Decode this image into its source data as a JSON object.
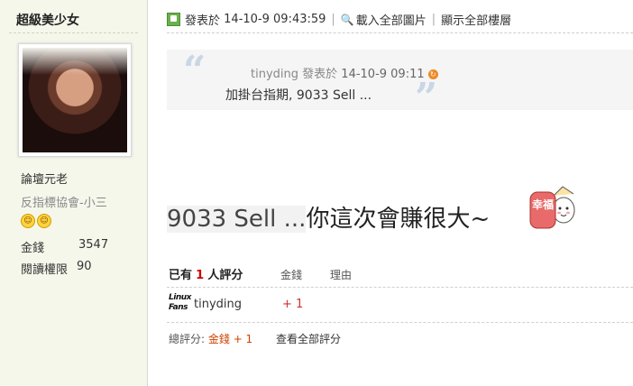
{
  "user": {
    "name": "超級美少女",
    "rank": "論壇元老",
    "group": "反指標協會-小三",
    "coins_label": "金錢",
    "coins_value": "3547",
    "read_label": "閱讀權限",
    "read_value": "90"
  },
  "post": {
    "posted_label": "發表於",
    "posted_time": "14-10-9 09:43:59",
    "load_images": "載入全部圖片",
    "show_all_floors": "顯示全部樓層",
    "quote": {
      "author": "tinyding",
      "posted_label": "發表於",
      "time": "14-10-9 09:11",
      "text": "加掛台指期, 9033 Sell ..."
    },
    "body_highlight": "9033 Sell ...",
    "body_text": "你這次會賺很大~",
    "sticker_text": "幸福"
  },
  "ratings": {
    "header_prefix": "已有",
    "count": "1",
    "header_suffix": "人評分",
    "col_money": "金錢",
    "col_reason": "理由",
    "badge": "Linux\nFans",
    "rows": [
      {
        "user": "tinyding",
        "score": "+ 1"
      }
    ],
    "total_label": "總評分:",
    "total_value": "金錢 + 1",
    "view_all": "查看全部評分"
  },
  "colors": {
    "sidebar_bg": "#f6f7eb",
    "score_red": "#c33",
    "quote_bg": "#f5f5f5"
  }
}
